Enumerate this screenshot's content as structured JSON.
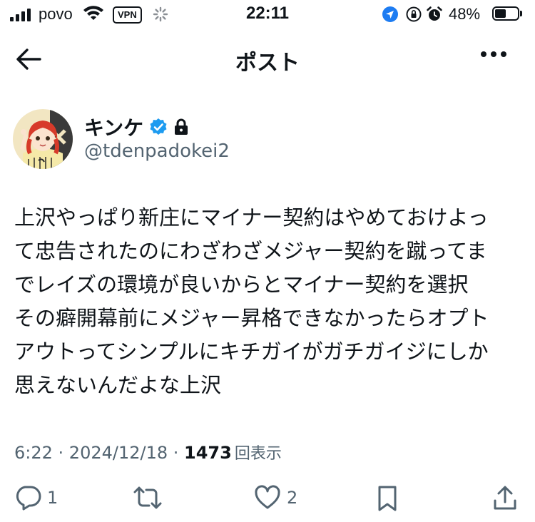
{
  "status_bar": {
    "carrier": "povo",
    "vpn": "VPN",
    "time": "22:11",
    "battery": "48%"
  },
  "header": {
    "title": "ポスト"
  },
  "author": {
    "name": "キンケ",
    "handle": "@tdenpadokei2"
  },
  "post": {
    "lines": [
      "上沢やっぱり新庄にマイナー契約はやめておけよっ",
      "て忠告されたのにわざわざメジャー契約を蹴ってま",
      "でレイズの環境が良いからとマイナー契約を選択",
      "その癖開幕前にメジャー昇格できなかったらオプト",
      "アウトってシンプルにキチガイがガチガイジにしか",
      "思えないんだよな上沢"
    ],
    "time": "6:22",
    "separator": " · ",
    "date": "2024/12/18",
    "views": "1473",
    "views_label": "回表示"
  },
  "actions": {
    "reply_count": "1",
    "like_count": "2"
  },
  "icons": {
    "back": "arrow-left-icon",
    "more": "more-horizontal-icon",
    "verified": "verified-badge-icon",
    "protected": "lock-icon",
    "reply": "reply-icon",
    "repost": "repost-icon",
    "like": "heart-icon",
    "bookmark": "bookmark-icon",
    "share": "share-icon"
  },
  "colors": {
    "text": "#0f1419",
    "secondary": "#536471",
    "verified": "#1d9bf0"
  }
}
